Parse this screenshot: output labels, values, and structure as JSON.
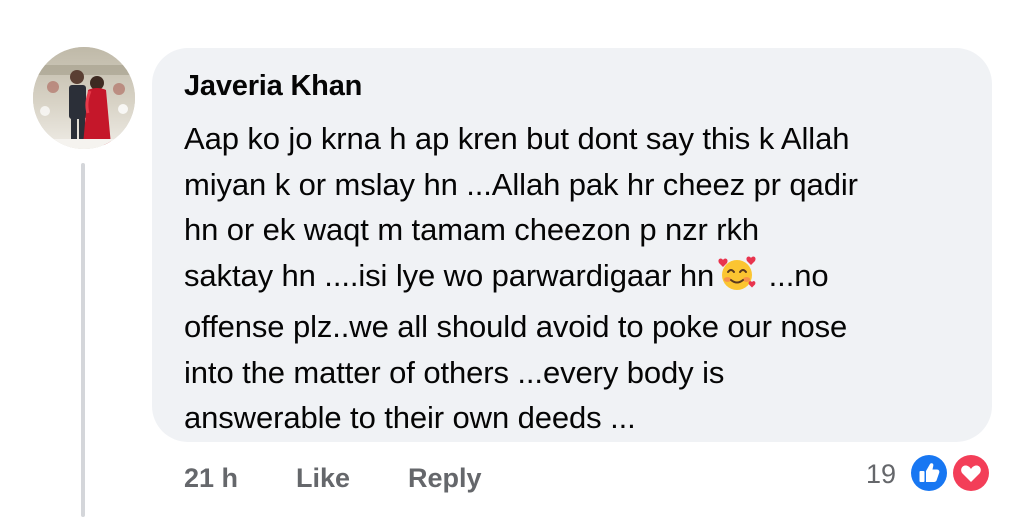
{
  "comment": {
    "author": "Javeria Khan",
    "text_before_emoji": "Aap ko jo krna h ap kren but dont say this k Allah\nmiyan k or mslay hn ...Allah pak hr cheez pr qadir\nhn or ek waqt m tamam cheezon p nzr rkh\nsaktay hn ....isi lye wo parwardigaar hn",
    "emoji": "smiling-face-with-hearts-emoji",
    "text_after_emoji": " ...no\noffense plz..we all should avoid to poke our nose\ninto the matter of others ...every body is\nanswerable to their own deeds ..."
  },
  "actions": {
    "time": "21 h",
    "like_label": "Like",
    "reply_label": "Reply"
  },
  "reactions": {
    "count": "19",
    "types": [
      "like-reaction-icon",
      "love-reaction-icon"
    ]
  },
  "colors": {
    "bubble_bg": "#f0f2f5",
    "text_primary": "#050505",
    "text_secondary": "#65676b",
    "like_blue": "#1877f2",
    "love_red": "#f33e58"
  }
}
